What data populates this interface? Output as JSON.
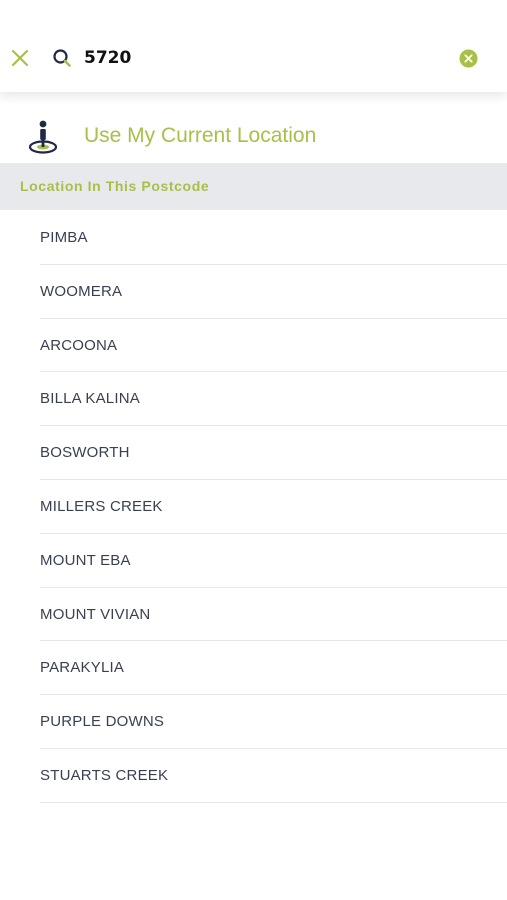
{
  "search": {
    "value": "5720",
    "close_icon": "close-icon",
    "search_icon": "search-icon",
    "clear_icon": "clear-icon"
  },
  "current_location": {
    "label": "Use My Current Location",
    "icon": "location-pin-icon"
  },
  "section": {
    "title": "Location In This Postcode"
  },
  "locations": [
    "PIMBA",
    "WOOMERA",
    "ARCOONA",
    "BILLA KALINA",
    "BOSWORTH",
    "MILLERS CREEK",
    "MOUNT EBA",
    "MOUNT VIVIAN",
    "PARAKYLIA",
    "PURPLE DOWNS",
    "STUARTS CREEK"
  ],
  "colors": {
    "accent": "#a6c048",
    "navy": "#1f2a44",
    "header_bg": "#e8e9ed",
    "text": "#3a4050"
  }
}
